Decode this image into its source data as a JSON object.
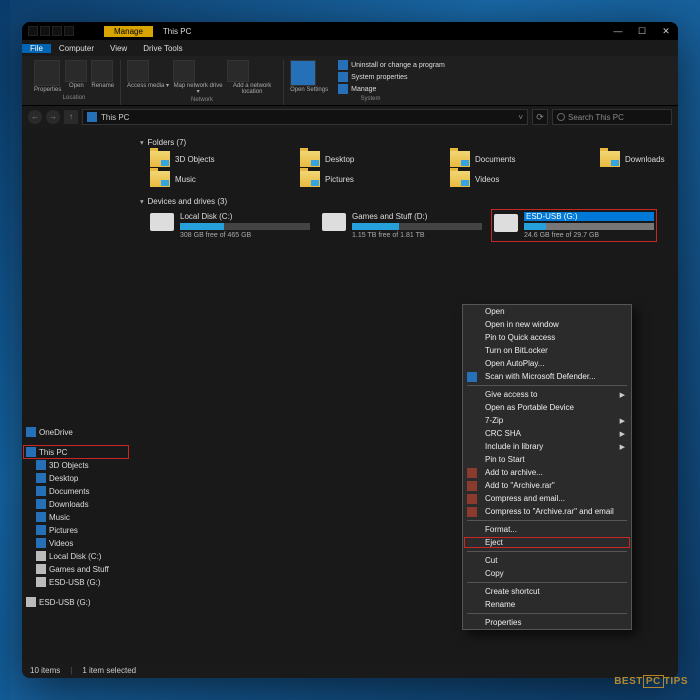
{
  "titlebar": {
    "context_tab": "Manage",
    "title": "This PC"
  },
  "wincontrols": {
    "min": "—",
    "max": "☐",
    "close": "✕"
  },
  "menubar": {
    "file": "File",
    "computer": "Computer",
    "view": "View",
    "drive_tools": "Drive Tools"
  },
  "ribbon": {
    "properties": "Properties",
    "open": "Open",
    "rename": "Rename",
    "access_media": "Access media ▾",
    "map_drive": "Map network drive ▾",
    "add_net": "Add a network location",
    "open_settings": "Open Settings",
    "uninstall": "Uninstall or change a program",
    "sysprops": "System properties",
    "manage": "Manage",
    "group_location": "Location",
    "group_network": "Network",
    "group_system": "System"
  },
  "address": {
    "location": "This PC",
    "search_placeholder": "Search This PC"
  },
  "sidebar": {
    "onedrive": "OneDrive",
    "thispc": "This PC",
    "items": [
      {
        "label": "3D Objects"
      },
      {
        "label": "Desktop"
      },
      {
        "label": "Documents"
      },
      {
        "label": "Downloads"
      },
      {
        "label": "Music"
      },
      {
        "label": "Pictures"
      },
      {
        "label": "Videos"
      },
      {
        "label": "Local Disk (C:)"
      },
      {
        "label": "Games and Stuff"
      },
      {
        "label": "ESD-USB (G:)"
      }
    ],
    "esd2": "ESD-USB (G:)"
  },
  "sections": {
    "folders": "Folders (7)",
    "devices": "Devices and drives (3)"
  },
  "folders": [
    {
      "label": "3D Objects"
    },
    {
      "label": "Desktop"
    },
    {
      "label": "Documents"
    },
    {
      "label": "Downloads"
    },
    {
      "label": "Music"
    },
    {
      "label": "Pictures"
    },
    {
      "label": "Videos"
    }
  ],
  "drives": [
    {
      "name": "Local Disk (C:)",
      "sub": "308 GB free of 465 GB",
      "fill": 34
    },
    {
      "name": "Games and Stuff (D:)",
      "sub": "1.15 TB free of 1.81 TB",
      "fill": 36
    },
    {
      "name": "ESD-USB (G:)",
      "sub": "24.6 GB free of 29.7 GB",
      "fill": 17
    }
  ],
  "ctx": [
    {
      "t": "Open"
    },
    {
      "t": "Open in new window"
    },
    {
      "t": "Pin to Quick access"
    },
    {
      "t": "Turn on BitLocker"
    },
    {
      "t": "Open AutoPlay..."
    },
    {
      "t": "Scan with Microsoft Defender...",
      "ic": "b"
    },
    {
      "sep": true
    },
    {
      "t": "Give access to",
      "arr": true
    },
    {
      "t": "Open as Portable Device"
    },
    {
      "t": "7-Zip",
      "arr": true
    },
    {
      "t": "CRC SHA",
      "arr": true
    },
    {
      "t": "Include in library",
      "arr": true
    },
    {
      "t": "Pin to Start"
    },
    {
      "t": "Add to archive...",
      "ic": "r"
    },
    {
      "t": "Add to \"Archive.rar\"",
      "ic": "r"
    },
    {
      "t": "Compress and email...",
      "ic": "r"
    },
    {
      "t": "Compress to \"Archive.rar\" and email",
      "ic": "r"
    },
    {
      "sep": true
    },
    {
      "t": "Format..."
    },
    {
      "t": "Eject",
      "hl": true
    },
    {
      "sep": true
    },
    {
      "t": "Cut"
    },
    {
      "t": "Copy"
    },
    {
      "sep": true
    },
    {
      "t": "Create shortcut"
    },
    {
      "t": "Rename"
    },
    {
      "sep": true
    },
    {
      "t": "Properties"
    }
  ],
  "status": {
    "count": "10 items",
    "selected": "1 item selected"
  },
  "watermark": {
    "a": "BEST",
    "b": "PC",
    "c": "TIPS"
  }
}
